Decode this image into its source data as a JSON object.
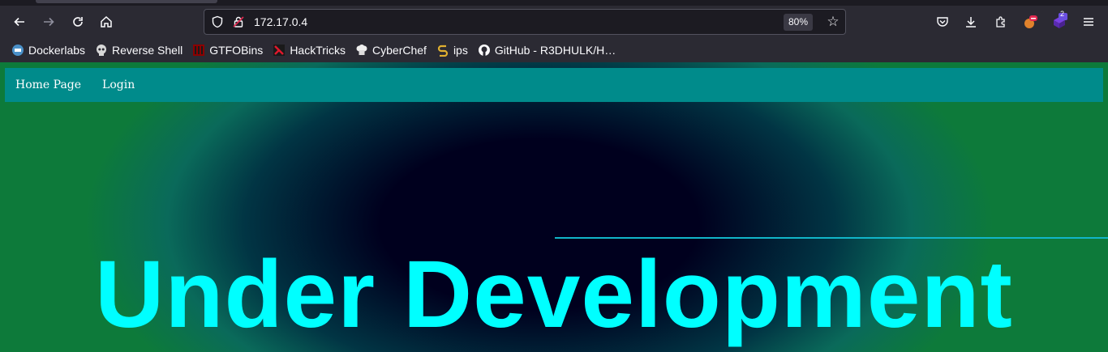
{
  "browser": {
    "url": "172.17.0.4",
    "zoom": "80%",
    "extension_badge": "2"
  },
  "bookmarks": [
    {
      "label": "Dockerlabs",
      "icon": "dockerlabs-icon"
    },
    {
      "label": "Reverse Shell",
      "icon": "skull-icon"
    },
    {
      "label": "GTFOBins",
      "icon": "gtfobins-icon"
    },
    {
      "label": "HackTricks",
      "icon": "hacktricks-icon"
    },
    {
      "label": "CyberChef",
      "icon": "chef-hat-icon"
    },
    {
      "label": "ips",
      "icon": "ips-icon"
    },
    {
      "label": "GitHub - R3DHULK/H…",
      "icon": "github-icon"
    }
  ],
  "site": {
    "nav": [
      "Home Page",
      "Login"
    ],
    "headline": "Under Development"
  },
  "colors": {
    "site_nav": "#008b8b",
    "headline": "#00ffff",
    "accent_line": "#11b5c8"
  }
}
